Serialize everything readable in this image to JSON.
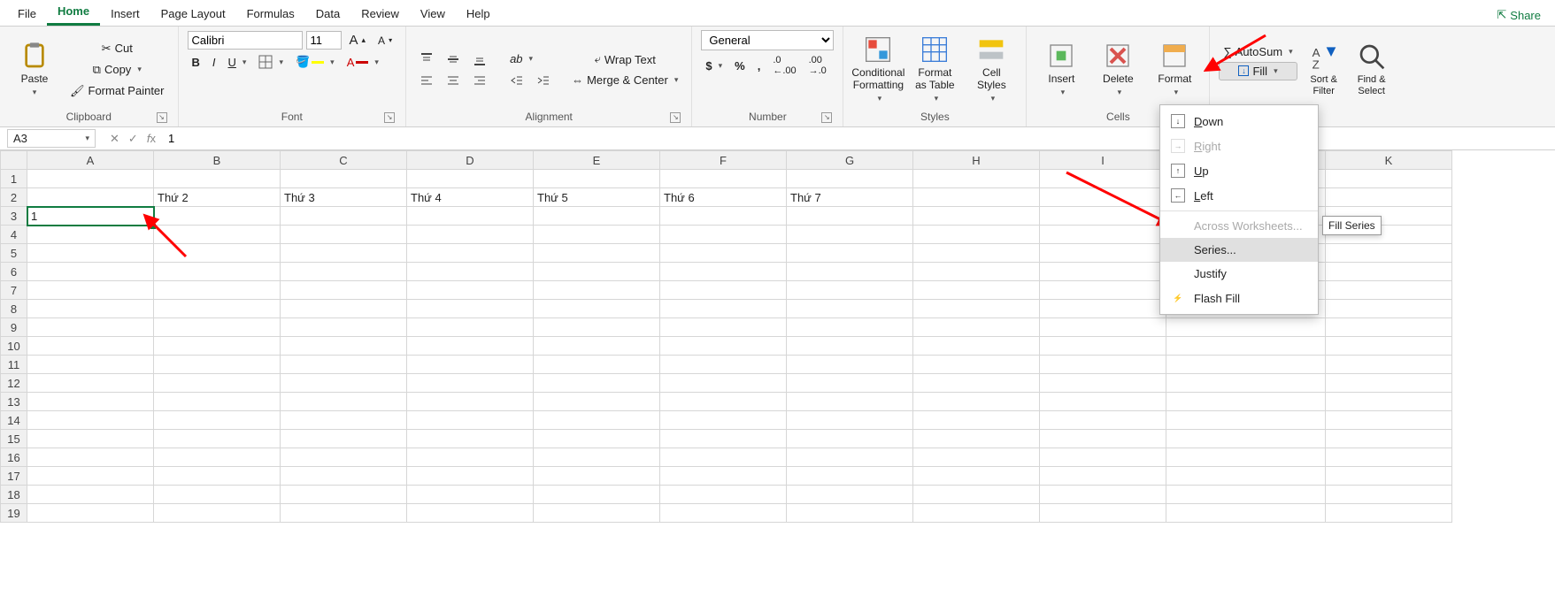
{
  "tabs": [
    "File",
    "Home",
    "Insert",
    "Page Layout",
    "Formulas",
    "Data",
    "Review",
    "View",
    "Help"
  ],
  "active_tab": "Home",
  "share": "Share",
  "clipboard": {
    "paste": "Paste",
    "cut": "Cut",
    "copy": "Copy",
    "format_painter": "Format Painter",
    "label": "Clipboard"
  },
  "font": {
    "name": "Calibri",
    "size": "11",
    "label": "Font"
  },
  "alignment": {
    "wrap": "Wrap Text",
    "merge": "Merge & Center",
    "label": "Alignment"
  },
  "number": {
    "format": "General",
    "label": "Number"
  },
  "styles": {
    "cond": "Conditional Formatting",
    "table": "Format as Table",
    "cell": "Cell Styles",
    "label": "Styles"
  },
  "cells": {
    "insert": "Insert",
    "delete": "Delete",
    "format": "Format",
    "label": "Cells"
  },
  "editing": {
    "autosum": "AutoSum",
    "fill": "Fill",
    "sort": "Sort & Filter",
    "find": "Find & Select"
  },
  "fill_menu": {
    "down": "Down",
    "right": "Right",
    "up": "Up",
    "left": "Left",
    "across": "Across Worksheets...",
    "series": "Series...",
    "justify": "Justify",
    "flash": "Flash Fill"
  },
  "tooltip": "Fill Series",
  "namebox": "A3",
  "formula": "1",
  "columns": [
    "A",
    "B",
    "C",
    "D",
    "E",
    "F",
    "G",
    "H",
    "I",
    "",
    "K"
  ],
  "row2": [
    "",
    "Thứ 2",
    "Thứ 3",
    "Thứ 4",
    "Thứ 5",
    "Thứ 6",
    "Thứ 7"
  ],
  "cellA3": "1",
  "row_count": 19
}
